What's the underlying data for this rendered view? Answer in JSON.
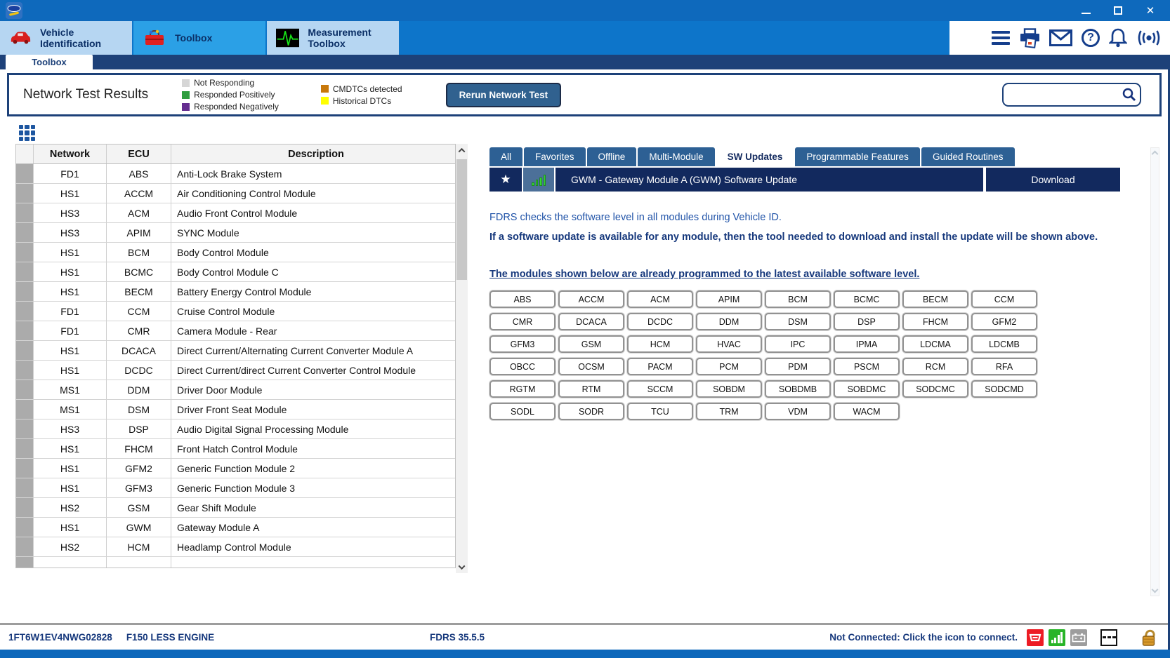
{
  "colors": {
    "titlebar_blue": "#0e69bc",
    "tab_row_blue": "#0d75ca",
    "active_app_tab": "#2ba0e6",
    "navy": "#1d4179",
    "deep_navy": "#12295e",
    "steel_tab": "#2d6094"
  },
  "app_tabs": [
    {
      "label": "Vehicle Identification",
      "icon": "car-icon",
      "active": false
    },
    {
      "label": "Toolbox",
      "icon": "toolbox-icon",
      "active": true
    },
    {
      "label": "Measurement Toolbox",
      "icon": "waveform-icon",
      "active": false
    }
  ],
  "sub_tab": {
    "label": "Toolbox"
  },
  "network_test": {
    "title": "Network Test Results",
    "legend": [
      {
        "label": "Not Responding",
        "color": "#d6d6d6",
        "group": 1
      },
      {
        "label": "Responded Positively",
        "color": "#2f9e3f",
        "group": 1
      },
      {
        "label": "Responded Negatively",
        "color": "#652d90",
        "group": 1
      },
      {
        "label": "CMDTCs detected",
        "color": "#c8780a",
        "group": 2
      },
      {
        "label": "Historical DTCs",
        "color": "#ffff00",
        "group": 2
      }
    ],
    "rerun_button": "Rerun Network Test",
    "search": {
      "value": "",
      "placeholder": ""
    }
  },
  "ecu_table": {
    "columns": [
      "Network",
      "ECU",
      "Description"
    ],
    "status_color": "#ababab",
    "rows": [
      {
        "network": "FD1",
        "ecu": "ABS",
        "description": "Anti-Lock Brake System"
      },
      {
        "network": "HS1",
        "ecu": "ACCM",
        "description": "Air Conditioning Control Module"
      },
      {
        "network": "HS3",
        "ecu": "ACM",
        "description": "Audio Front Control Module"
      },
      {
        "network": "HS3",
        "ecu": "APIM",
        "description": "SYNC Module"
      },
      {
        "network": "HS1",
        "ecu": "BCM",
        "description": "Body Control Module"
      },
      {
        "network": "HS1",
        "ecu": "BCMC",
        "description": "Body Control Module C"
      },
      {
        "network": "HS1",
        "ecu": "BECM",
        "description": "Battery Energy Control Module"
      },
      {
        "network": "FD1",
        "ecu": "CCM",
        "description": "Cruise Control Module"
      },
      {
        "network": "FD1",
        "ecu": "CMR",
        "description": "Camera Module - Rear"
      },
      {
        "network": "HS1",
        "ecu": "DCACA",
        "description": "Direct Current/Alternating Current Converter Module A"
      },
      {
        "network": "HS1",
        "ecu": "DCDC",
        "description": "Direct Current/direct Current Converter Control Module"
      },
      {
        "network": "MS1",
        "ecu": "DDM",
        "description": "Driver Door Module"
      },
      {
        "network": "MS1",
        "ecu": "DSM",
        "description": "Driver Front Seat Module"
      },
      {
        "network": "HS3",
        "ecu": "DSP",
        "description": "Audio Digital Signal Processing Module"
      },
      {
        "network": "HS1",
        "ecu": "FHCM",
        "description": "Front Hatch Control Module"
      },
      {
        "network": "HS1",
        "ecu": "GFM2",
        "description": "Generic Function Module 2"
      },
      {
        "network": "HS1",
        "ecu": "GFM3",
        "description": "Generic Function Module 3"
      },
      {
        "network": "HS2",
        "ecu": "GSM",
        "description": "Gear Shift Module"
      },
      {
        "network": "HS1",
        "ecu": "GWM",
        "description": "Gateway Module A"
      },
      {
        "network": "HS2",
        "ecu": "HCM",
        "description": "Headlamp Control Module"
      }
    ]
  },
  "right_panel": {
    "tabs": [
      {
        "label": "All"
      },
      {
        "label": "Favorites"
      },
      {
        "label": "Offline"
      },
      {
        "label": "Multi-Module"
      },
      {
        "label": "SW Updates"
      },
      {
        "label": "Programmable Features"
      },
      {
        "label": "Guided Routines"
      }
    ],
    "active_tab": "SW Updates",
    "update_row": {
      "icons": [
        "favorite-star-icon",
        "signal-bars-icon"
      ],
      "title": "GWM - Gateway Module A (GWM) Software Update",
      "action": "Download"
    },
    "info_line1": "FDRS checks the software level in all modules during Vehicle ID.",
    "info_line2": "If a software update is available for any module, then the tool needed to download and install the update will be shown above.",
    "modules_heading": "The modules shown below are already programmed to the latest available software level.",
    "modules": [
      "ABS",
      "ACCM",
      "ACM",
      "APIM",
      "BCM",
      "BCMC",
      "BECM",
      "CCM",
      "CMR",
      "DCACA",
      "DCDC",
      "DDM",
      "DSM",
      "DSP",
      "FHCM",
      "GFM2",
      "GFM3",
      "GSM",
      "HCM",
      "HVAC",
      "IPC",
      "IPMA",
      "LDCMA",
      "LDCMB",
      "OBCC",
      "OCSM",
      "PACM",
      "PCM",
      "PDM",
      "PSCM",
      "RCM",
      "RFA",
      "RGTM",
      "RTM",
      "SCCM",
      "SOBDM",
      "SOBDMB",
      "SOBDMC",
      "SODCMC",
      "SODCMD",
      "SODL",
      "SODR",
      "TCU",
      "TRM",
      "VDM",
      "WACM"
    ]
  },
  "status_bar": {
    "vin": "1FT6W1EV4NWG02828",
    "vehicle": "F150 LESS ENGINE",
    "version": "FDRS 35.5.5",
    "connection_message": "Not Connected: Click the icon to connect.",
    "icons": [
      "vci-disconnected-icon",
      "network-signal-icon",
      "battery-icon",
      "voltage-dashes-icon",
      "unlocked-padlock-icon"
    ]
  }
}
